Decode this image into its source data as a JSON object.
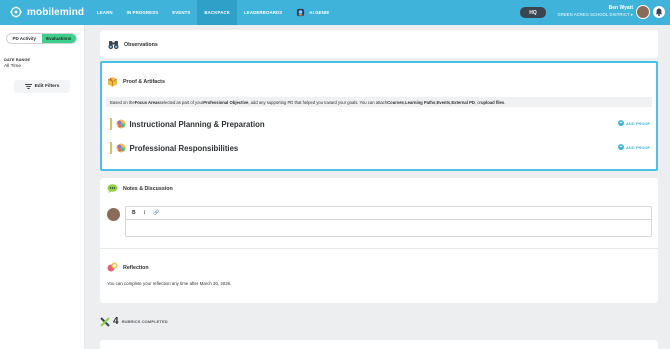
{
  "brand": {
    "name": "mobilemind"
  },
  "nav": {
    "items": [
      {
        "label": "LEARN"
      },
      {
        "label": "IN PROGRESS"
      },
      {
        "label": "EVENTS"
      },
      {
        "label": "BACKPACK"
      },
      {
        "label": "LEADERBOARDS"
      },
      {
        "label": "AI GENIE"
      }
    ],
    "active": "BACKPACK"
  },
  "header": {
    "hq_label": "HQ",
    "user_name": "Ben Wyatt",
    "user_org": "GREEN ACRES SCHOOL DISTRICT ▾"
  },
  "sidebar": {
    "tabs": [
      {
        "label": "PD Activity"
      },
      {
        "label": "Evaluations"
      }
    ],
    "date_range_label": "DATE RANGE",
    "date_range_value": "All Time",
    "edit_filters_label": "Edit Filters"
  },
  "observations": {
    "title": "Observations"
  },
  "proof": {
    "title": "Proof & Artifacts",
    "desc": {
      "p1": "Based on the ",
      "b1": "Focus Areas",
      "p2": " selected as part of your ",
      "b2": "Professional Objective",
      "p3": ", add any supporting PD that helped you toward your goals. You can attach ",
      "b3": "Courses",
      "p4": ", ",
      "b4": "Learning Paths",
      "p5": ", ",
      "b5": "Events",
      "p6": ", ",
      "b6": "External PD",
      "p7": ", or ",
      "b7": "upload files",
      "p8": "."
    },
    "areas": [
      {
        "title": "Instructional Planning & Preparation",
        "action": "ADD PROOF"
      },
      {
        "title": "Professional Responsibilities",
        "action": "ADD PROOF"
      }
    ]
  },
  "notes": {
    "title": "Notes & Discussion",
    "toolbar": {
      "bold": "B",
      "italic": "I",
      "link": "🔗"
    }
  },
  "reflection": {
    "title": "Reflection",
    "text": "You can complete your reflection any time after March 30, 2026."
  },
  "rubrics": {
    "count": "4",
    "label": "RUBRICS COMPLETED"
  },
  "colors": {
    "topbar": "#3fb3d9",
    "accent_green": "#3dcf8e",
    "highlight_border": "#4bc0e2"
  }
}
